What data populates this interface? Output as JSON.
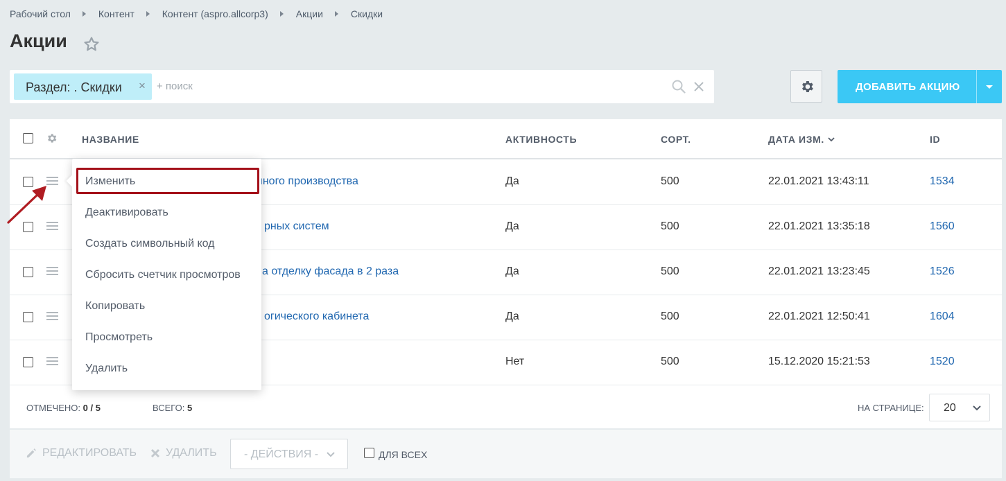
{
  "breadcrumb": [
    "Рабочий стол",
    "Контент",
    "Контент (aspro.allcorp3)",
    "Акции",
    "Скидки"
  ],
  "page": {
    "title": "Акции"
  },
  "filter": {
    "chip_label": "Раздел: . Скидки",
    "chip_close": "×",
    "search_placeholder": "+ поиск"
  },
  "toolbar": {
    "add_label": "ДОБАВИТЬ АКЦИЮ"
  },
  "grid": {
    "columns": {
      "name": "НАЗВАНИЕ",
      "active": "АКТИВНОСТЬ",
      "sort": "СОРТ.",
      "date": "ДАТА ИЗМ.",
      "id": "ID"
    },
    "sorted_column": "date",
    "rows": [
      {
        "name": "нного производства",
        "active": "Да",
        "sort": "500",
        "date": "22.01.2021 13:43:11",
        "id": "1534"
      },
      {
        "name": "рных систем",
        "active": "Да",
        "sort": "500",
        "date": "22.01.2021 13:35:18",
        "id": "1560"
      },
      {
        "name": "а отделку фасада в 2 раза",
        "active": "Да",
        "sort": "500",
        "date": "22.01.2021 13:23:45",
        "id": "1526"
      },
      {
        "name": "огического кабинета",
        "active": "Да",
        "sort": "500",
        "date": "22.01.2021 12:50:41",
        "id": "1604"
      },
      {
        "name": "",
        "active": "Нет",
        "sort": "500",
        "date": "15.12.2020 15:21:53",
        "id": "1520"
      }
    ]
  },
  "footer": {
    "marked_label": "ОТМЕЧЕНО:",
    "marked_value": "0 / 5",
    "total_label": "ВСЕГО:",
    "total_value": "5",
    "per_page_label": "НА СТРАНИЦЕ:",
    "per_page_value": "20"
  },
  "actions": {
    "edit": "РЕДАКТИРОВАТЬ",
    "delete": "УДАЛИТЬ",
    "dropdown": "- ДЕЙСТВИЯ -",
    "for_all": "ДЛЯ ВСЕХ"
  },
  "context_menu": {
    "items": [
      "Изменить",
      "Деактивировать",
      "Создать символьный код",
      "Сбросить счетчик просмотров",
      "Копировать",
      "Просмотреть",
      "Удалить"
    ],
    "highlighted_index": 0
  },
  "colors": {
    "accent": "#3bc8f5",
    "chip": "#bfeef9",
    "link": "#2067b0",
    "highlight_border": "#a4111a",
    "annotation_arrow": "#b01c22",
    "background": "#e6ebed"
  },
  "icons": [
    "star-icon",
    "search-icon",
    "clear-icon",
    "gear-icon",
    "chevron-down-icon",
    "menu-icon",
    "pencil-icon",
    "cross-icon",
    "annotation-arrow"
  ]
}
